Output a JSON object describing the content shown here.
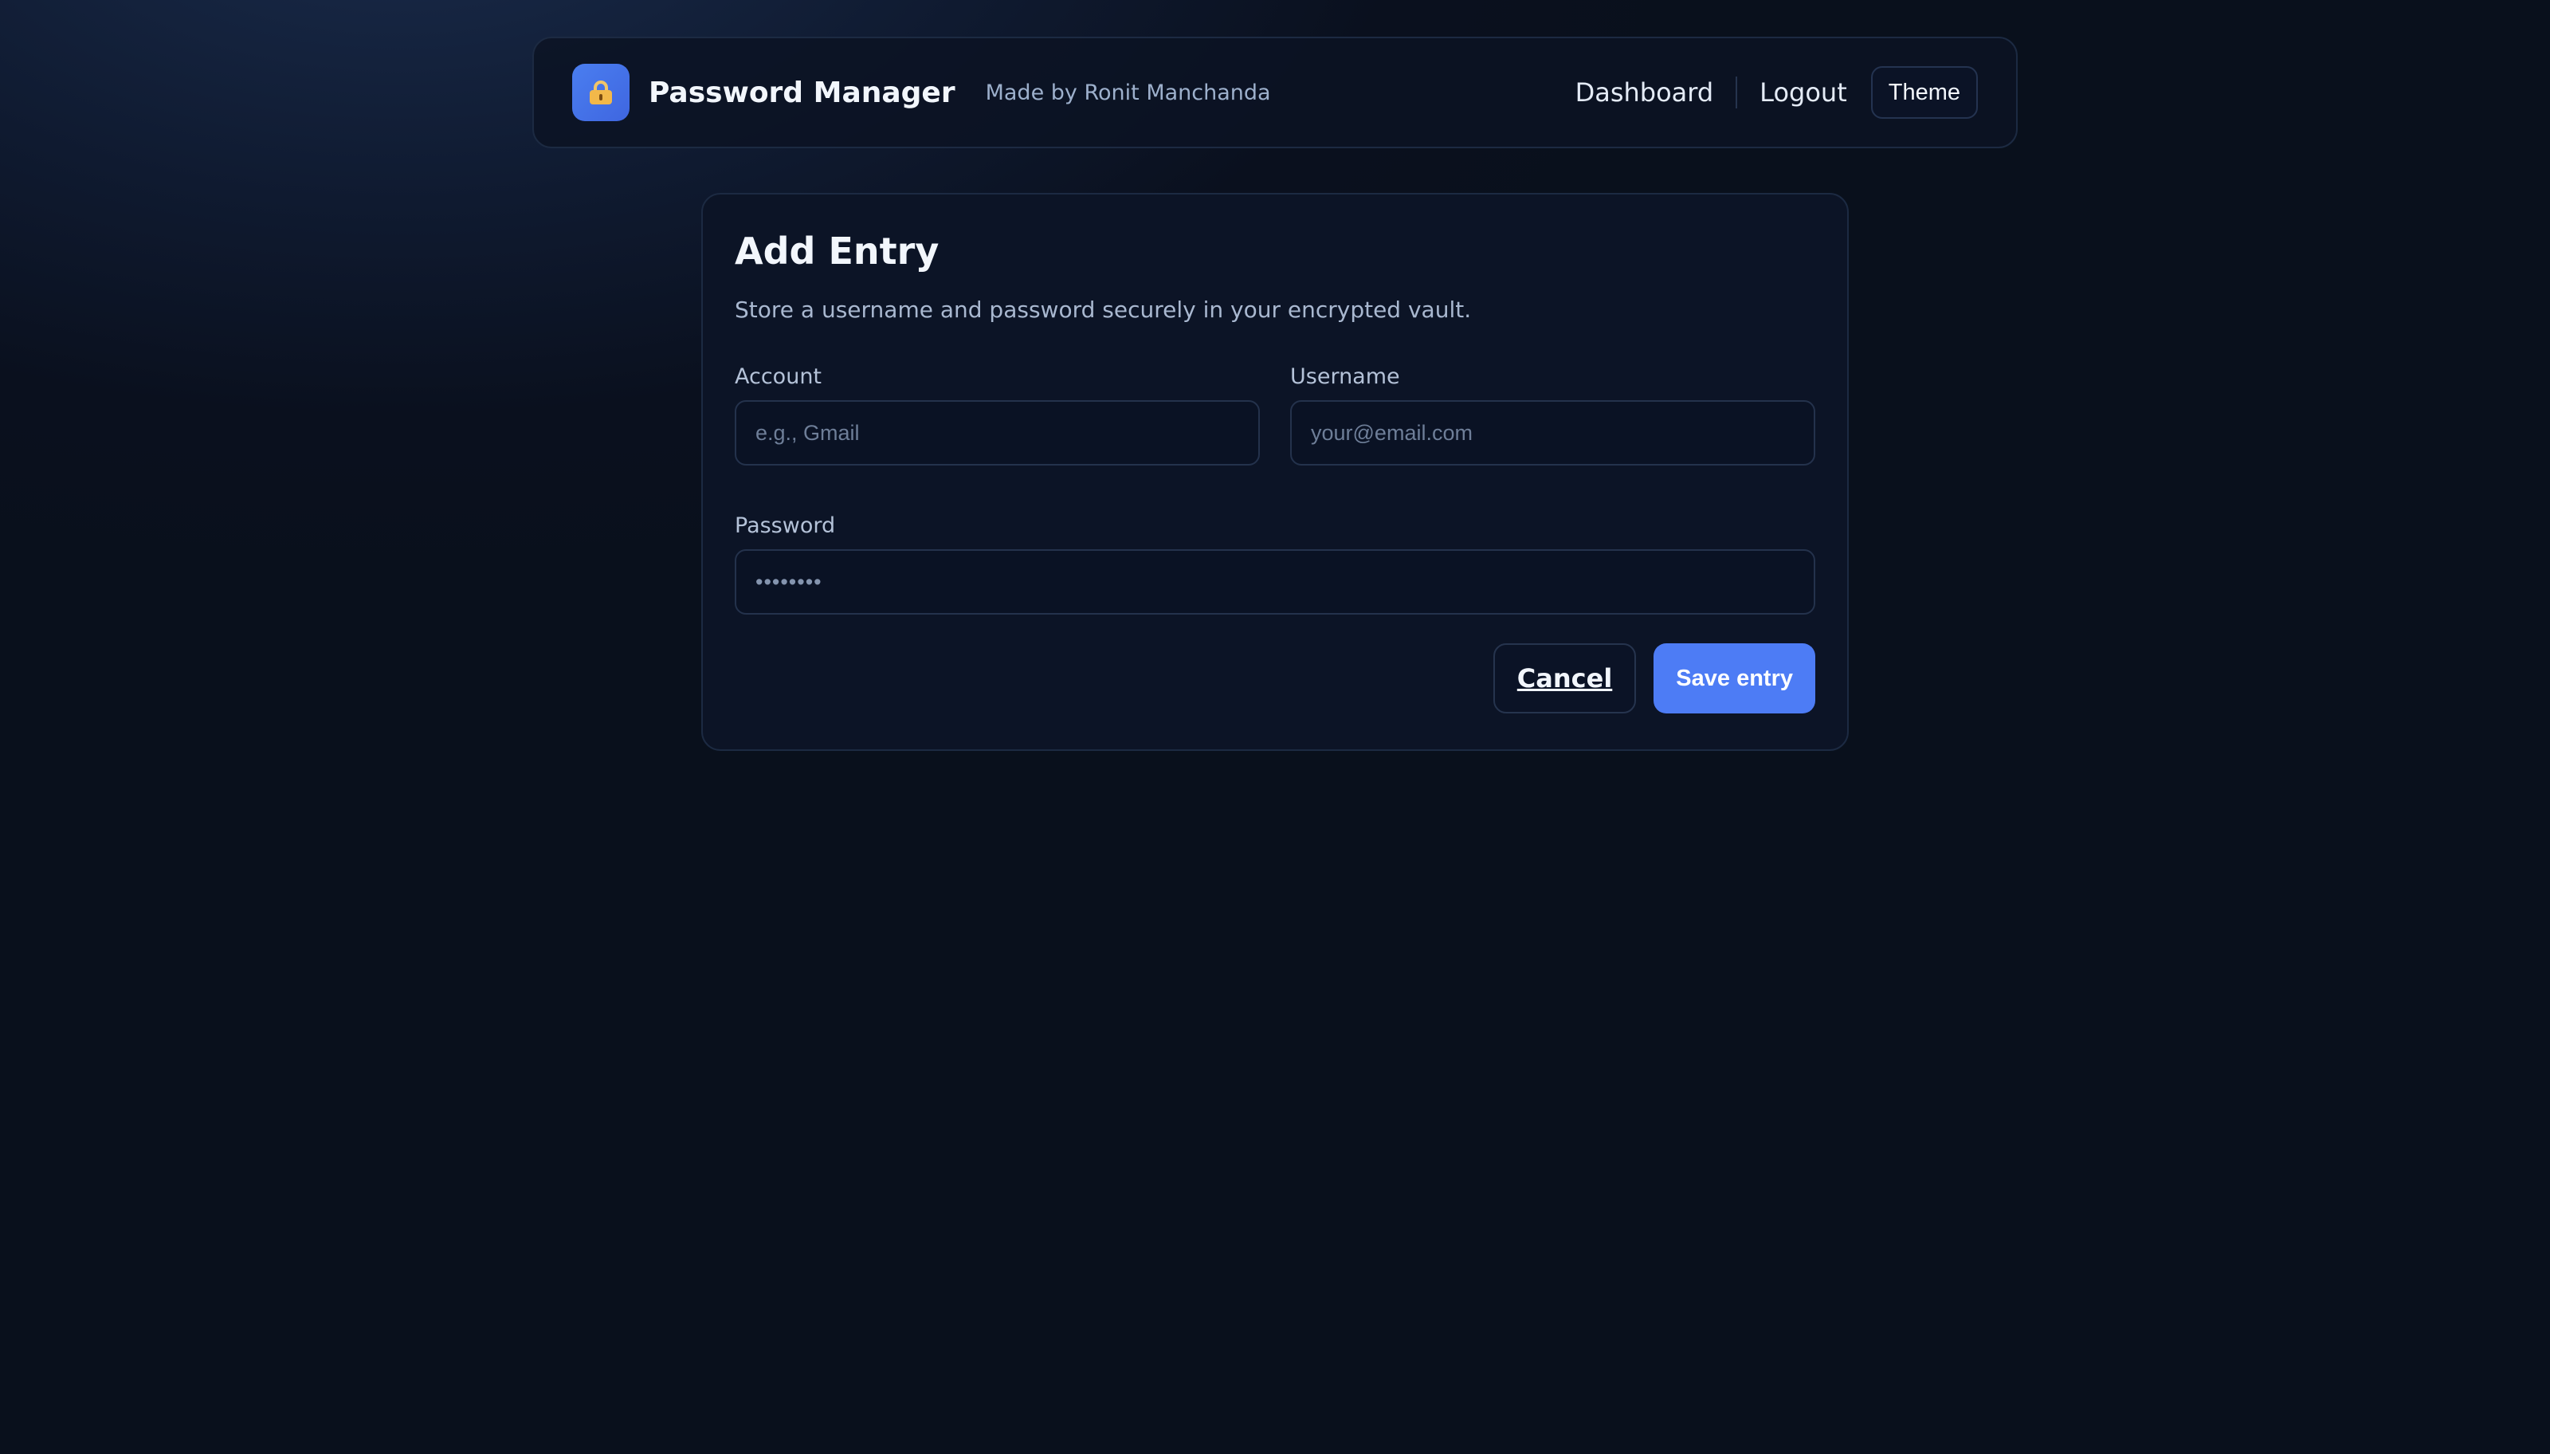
{
  "header": {
    "logo_icon": "lock-icon",
    "title": "Password Manager",
    "subtitle": "Made by Ronit Manchanda",
    "nav": {
      "dashboard": "Dashboard",
      "logout": "Logout",
      "theme": "Theme"
    }
  },
  "form": {
    "title": "Add Entry",
    "description": "Store a username and password securely in your encrypted vault.",
    "account": {
      "label": "Account",
      "value": "",
      "placeholder": "e.g., Gmail"
    },
    "username": {
      "label": "Username",
      "value": "",
      "placeholder": "your@email.com"
    },
    "password": {
      "label": "Password",
      "value": "",
      "placeholder": "••••••••"
    },
    "cancel_label": "Cancel",
    "save_label": "Save entry"
  },
  "colors": {
    "accent": "#4d7cf5",
    "background": "#09101c",
    "card": "#0c1426"
  }
}
